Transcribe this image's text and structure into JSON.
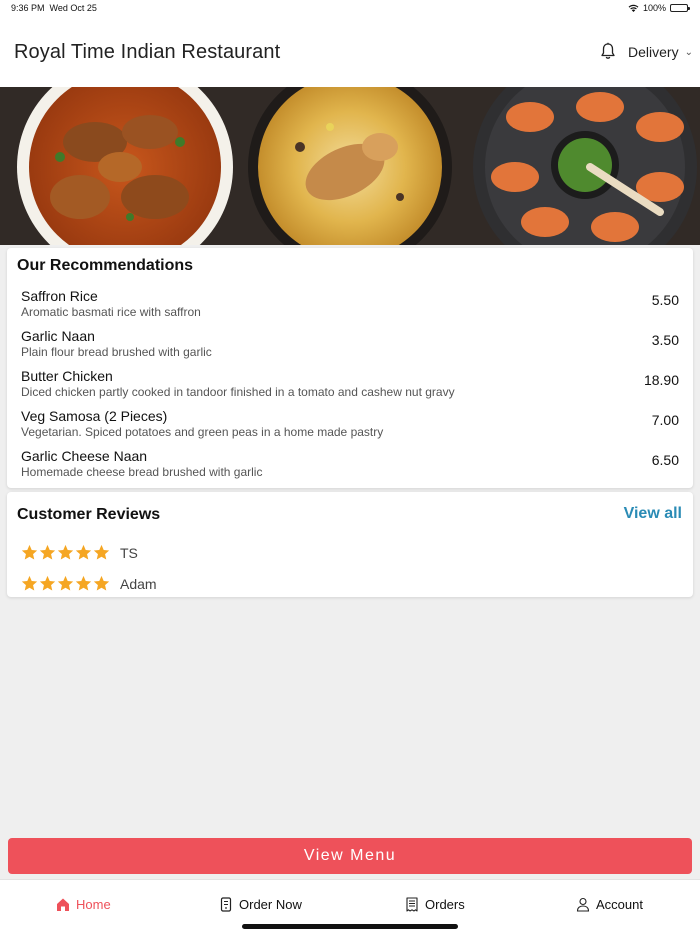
{
  "status_bar": {
    "time": "9:36 PM",
    "date": "Wed Oct 25",
    "battery": "100%",
    "battery_level": 1.0,
    "icons": [
      "wifi-icon",
      "battery-icon"
    ]
  },
  "header": {
    "title": "Royal Time Indian Restaurant",
    "notification_icon": "bell-icon",
    "delivery_label": "Delivery",
    "delivery_icon": "chevron-down-icon"
  },
  "recommendations": {
    "title": "Our Recommendations",
    "items": [
      {
        "name": "Saffron Rice",
        "description": "Aromatic basmati rice with saffron",
        "price": "5.50"
      },
      {
        "name": "Garlic Naan",
        "description": "Plain flour bread brushed with garlic",
        "price": "3.50"
      },
      {
        "name": "Butter Chicken",
        "description": "Diced chicken partly cooked in tandoor finished in a tomato and cashew nut gravy",
        "price": "18.90"
      },
      {
        "name": "Veg Samosa (2 Pieces)",
        "description": "Vegetarian. Spiced potatoes and green peas in a home made pastry",
        "price": "7.00"
      },
      {
        "name": "Garlic Cheese Naan",
        "description": "Homemade cheese bread brushed with garlic",
        "price": "6.50"
      }
    ]
  },
  "reviews": {
    "title": "Customer Reviews",
    "view_all_label": "View all",
    "items": [
      {
        "name": "TS",
        "rating": 5
      },
      {
        "name": "Adam",
        "rating": 5
      }
    ],
    "star_color": "#f5a623"
  },
  "view_menu_label": "View Menu",
  "nav": {
    "items": [
      {
        "label": "Home",
        "icon": "home-icon",
        "active": true
      },
      {
        "label": "Order Now",
        "icon": "order-icon",
        "active": false
      },
      {
        "label": "Orders",
        "icon": "receipt-icon",
        "active": false
      },
      {
        "label": "Account",
        "icon": "user-icon",
        "active": false
      }
    ]
  },
  "colors": {
    "accent": "#ee515a",
    "link": "#2a8bb5"
  }
}
